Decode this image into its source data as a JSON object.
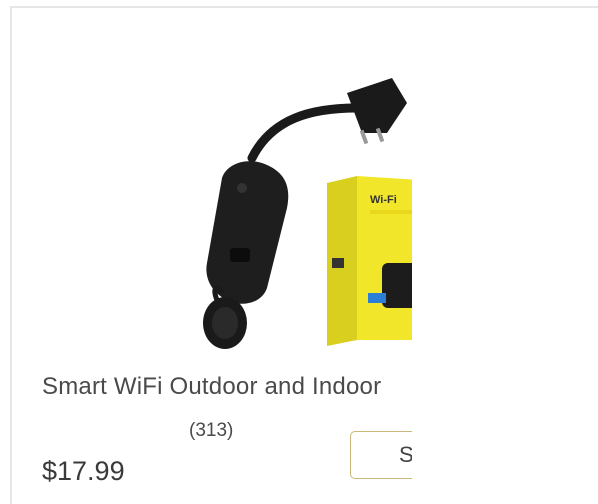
{
  "product": {
    "title": "Smart WiFi Outdoor and Indoor",
    "rating_count": "(313)",
    "price": "$17.99",
    "button_label": "Shop",
    "package_label": "Wi-Fi"
  },
  "colors": {
    "box_yellow": "#f2e62a",
    "plug_black": "#1a1a1a",
    "button_border": "#c9b77c",
    "text": "#4a4a4a"
  }
}
